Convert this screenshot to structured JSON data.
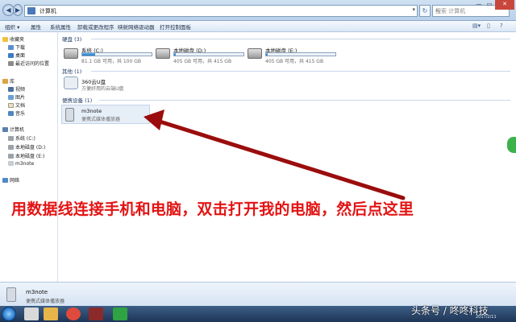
{
  "window": {
    "breadcrumb": "计算机",
    "search_placeholder": "搜索 计算机"
  },
  "toolbar": {
    "items": [
      "组织 ▾",
      "属性",
      "系统属性",
      "卸载或更改程序",
      "映射网络驱动器",
      "打开控制面板"
    ]
  },
  "sidebar": {
    "favorites": "收藏夹",
    "downloads": "下载",
    "desktop": "桌面",
    "recent": "最近访问的位置",
    "libraries": "库",
    "videos": "视频",
    "pictures": "图片",
    "documents": "文档",
    "music": "音乐",
    "computer": "计算机",
    "drive_c": "系统 (C:)",
    "drive_d": "本地磁盘 (D:)",
    "drive_e": "本地磁盘 (E:)",
    "device": "m3note",
    "network": "网络"
  },
  "groups": {
    "hard_disks": "硬盘 (3)",
    "other": "其他 (1)",
    "portable": "便携设备 (1)"
  },
  "drives": [
    {
      "name": "系统 (C:)",
      "info": "81.1 GB 可用，共 100 GB",
      "used_fraction": 0.19
    },
    {
      "name": "本地磁盘 (D:)",
      "info": "405 GB 可用，共 415 GB",
      "used_fraction": 0.02
    },
    {
      "name": "本地磁盘 (E:)",
      "info": "405 GB 可用，共 415 GB",
      "used_fraction": 0.02
    }
  ],
  "other_item": {
    "title": "360云U盘",
    "subtitle": "方便好用的云端U盘"
  },
  "portable_item": {
    "title": "m3note",
    "subtitle": "便携式媒体播放器"
  },
  "annotation": "用数据线连接手机和电脑，双击打开我的电脑，然后点这里",
  "details": {
    "title": "m3note",
    "subtitle": "便携式媒体播放器"
  },
  "watermark": "头条号 / 咚咚科技",
  "clock": "2017/2/11",
  "colors": {
    "annotation": "#e31313",
    "arrow": "#9b0d0d",
    "drive_fill": "#2675c1"
  }
}
